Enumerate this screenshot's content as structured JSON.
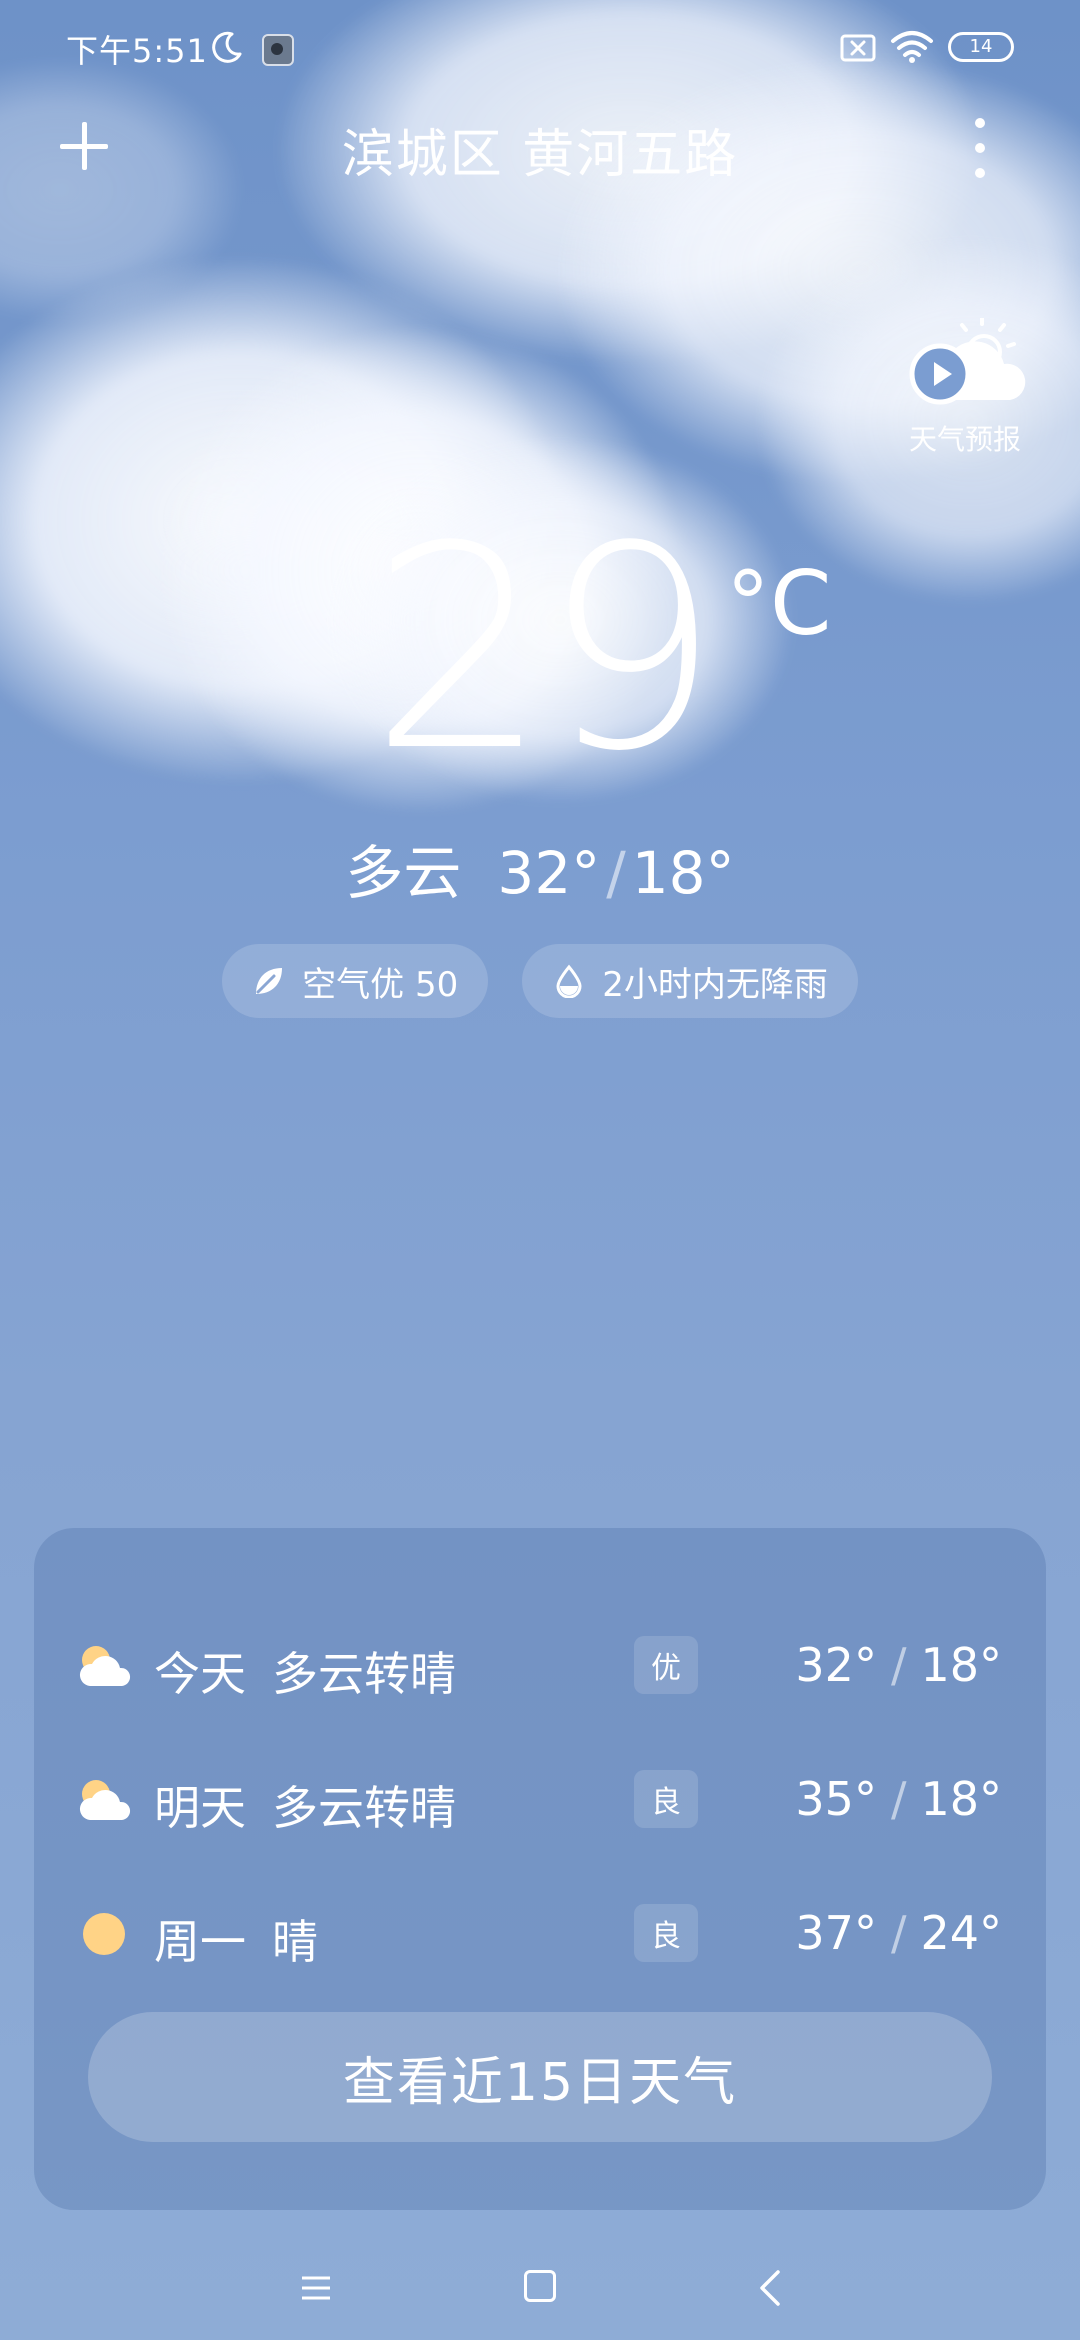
{
  "status_bar": {
    "time": "下午5:51",
    "battery_level": "14"
  },
  "header": {
    "location": "滨城区 黄河五路",
    "forecast_video_label": "天气预报"
  },
  "current": {
    "temperature": "29",
    "unit": "°C",
    "condition": "多云",
    "high": "32°",
    "low": "18°",
    "air_quality": "空气优 50",
    "rain": "2小时内无降雨"
  },
  "forecast": [
    {
      "day": "今天",
      "condition": "多云转晴",
      "aqi": "优",
      "high": "32°",
      "low": "18°",
      "icon": "partly-cloudy-icon"
    },
    {
      "day": "明天",
      "condition": "多云转晴",
      "aqi": "良",
      "high": "35°",
      "low": "18°",
      "icon": "partly-cloudy-icon"
    },
    {
      "day": "周一",
      "condition": "晴",
      "aqi": "良",
      "high": "37°",
      "low": "24°",
      "icon": "sun-icon"
    }
  ],
  "forecast_button_label": "查看近15日天气",
  "colors": {
    "sky_top": "#6e92c8",
    "sky_bottom": "#8eacd6",
    "sun": "#ffd386",
    "text": "#ffffff"
  }
}
